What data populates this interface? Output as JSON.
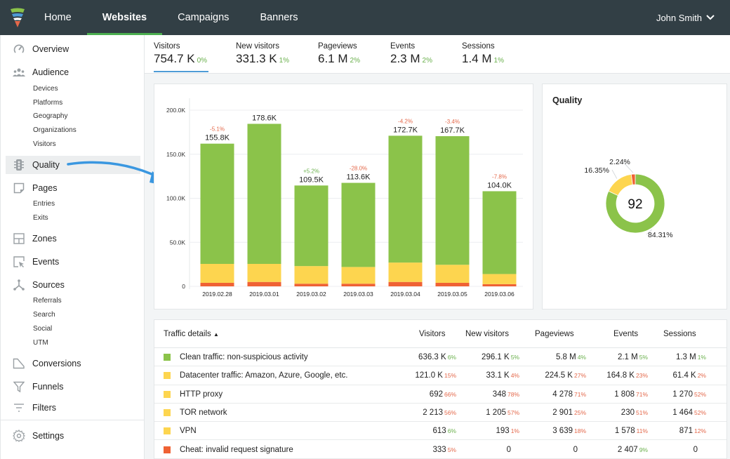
{
  "topbar": {
    "logo": "funnel-logo",
    "nav": [
      {
        "label": "Home",
        "active": false
      },
      {
        "label": "Websites",
        "active": true
      },
      {
        "label": "Campaigns",
        "active": false
      },
      {
        "label": "Banners",
        "active": false
      }
    ],
    "user": "John Smith"
  },
  "sidebar": {
    "items": [
      {
        "label": "Overview",
        "icon": "gauge-icon"
      },
      {
        "label": "Audience",
        "icon": "people-icon",
        "sub": [
          "Devices",
          "Platforms",
          "Geography",
          "Organizations",
          "Visitors"
        ]
      },
      {
        "label": "Quality",
        "icon": "traffic-light-icon",
        "active": true
      },
      {
        "label": "Pages",
        "icon": "page-icon",
        "sub": [
          "Entries",
          "Exits"
        ]
      },
      {
        "label": "Zones",
        "icon": "layout-icon"
      },
      {
        "label": "Events",
        "icon": "cursor-icon"
      },
      {
        "label": "Sources",
        "icon": "sources-icon",
        "sub": [
          "Referrals",
          "Search",
          "Social",
          "UTM"
        ]
      },
      {
        "label": "Conversions",
        "icon": "conversion-icon"
      },
      {
        "label": "Funnels",
        "icon": "funnel-icon"
      },
      {
        "label": "Filters",
        "icon": "filter-icon"
      },
      {
        "label": "Settings",
        "icon": "gear-icon"
      }
    ]
  },
  "metrics": [
    {
      "label": "Visitors",
      "value": "754.7 K",
      "change": "0%",
      "active": true
    },
    {
      "label": "New visitors",
      "value": "331.3 K",
      "change": "1%"
    },
    {
      "label": "Pageviews",
      "value": "6.1 M",
      "change": "2%"
    },
    {
      "label": "Events",
      "value": "2.3 M",
      "change": "2%"
    },
    {
      "label": "Sessions",
      "value": "1.4 M",
      "change": "1%"
    }
  ],
  "colors": {
    "clean": "#8bc34a",
    "suspicious": "#fdd54f",
    "cheat": "#ef6234",
    "up": "#6ab04c",
    "down": "#e4684a",
    "accent": "#4e9bd6",
    "topbar": "#323f45"
  },
  "chart_data": [
    {
      "type": "bar",
      "stacked": true,
      "title": "",
      "xlabel": "",
      "ylabel": "",
      "ylim": [
        0,
        200000
      ],
      "yticks": [
        "0",
        "50.0K",
        "100.0K",
        "150.0K",
        "200.0K"
      ],
      "categories": [
        "2019.02.28",
        "2019.03.01",
        "2019.03.02",
        "2019.03.03",
        "2019.03.04",
        "2019.03.05",
        "2019.03.06"
      ],
      "totals_labels": [
        "155.8K",
        "178.6K",
        "109.5K",
        "113.6K",
        "172.7K",
        "167.7K",
        "104.0K"
      ],
      "change_labels": [
        "-5.1%",
        "",
        "+5.2%",
        "-28.0%",
        "-4.2%",
        "-3.4%",
        "-7.8%"
      ],
      "series": [
        {
          "name": "Cheat",
          "color": "#ef6234",
          "values": [
            4000,
            5000,
            3000,
            3000,
            5000,
            4000,
            2500
          ]
        },
        {
          "name": "Suspicious",
          "color": "#fdd54f",
          "values": [
            21500,
            20500,
            20000,
            19000,
            22000,
            20500,
            11500
          ]
        },
        {
          "name": "Clean",
          "color": "#8bc34a",
          "values": [
            136500,
            159000,
            91500,
            95500,
            144000,
            146000,
            94000
          ]
        }
      ],
      "grid": true,
      "legend": "none"
    },
    {
      "type": "pie",
      "donut": true,
      "title": "Quality",
      "center_label": "92",
      "slices": [
        {
          "label": "84.31%",
          "value": 84.31,
          "color": "#8bc34a"
        },
        {
          "label": "16.35%",
          "value": 16.35,
          "color": "#fdd54f"
        },
        {
          "label": "2.24%",
          "value": 2.24,
          "color": "#ef6234"
        }
      ]
    }
  ],
  "table": {
    "headers": [
      "Traffic details",
      "Visitors",
      "New visitors",
      "Pageviews",
      "Events",
      "Sessions"
    ],
    "sort_indicator": "▲",
    "rows": [
      {
        "name": "Clean traffic: non-suspicious activity",
        "color": "#8bc34a",
        "cells": [
          [
            "636.3 K",
            "6%",
            "g"
          ],
          [
            "296.1 K",
            "5%",
            "g"
          ],
          [
            "5.8 M",
            "4%",
            "g"
          ],
          [
            "2.1 M",
            "5%",
            "g"
          ],
          [
            "1.3 M",
            "1%",
            "g"
          ]
        ]
      },
      {
        "name": "Datacenter traffic: Amazon, Azure, Google, etc.",
        "color": "#fdd54f",
        "cells": [
          [
            "121.0 K",
            "15%",
            "r"
          ],
          [
            "33.1 K",
            "4%",
            "r"
          ],
          [
            "224.5 K",
            "27%",
            "r"
          ],
          [
            "164.8 K",
            "23%",
            "r"
          ],
          [
            "61.4 K",
            "2%",
            "r"
          ]
        ]
      },
      {
        "name": "HTTP proxy",
        "color": "#fdd54f",
        "cells": [
          [
            "692",
            "66%",
            "r"
          ],
          [
            "348",
            "78%",
            "r"
          ],
          [
            "4 278",
            "71%",
            "r"
          ],
          [
            "1 808",
            "71%",
            "r"
          ],
          [
            "1 270",
            "52%",
            "r"
          ]
        ]
      },
      {
        "name": "TOR network",
        "color": "#fdd54f",
        "cells": [
          [
            "2 213",
            "56%",
            "r"
          ],
          [
            "1 205",
            "57%",
            "r"
          ],
          [
            "2 901",
            "25%",
            "r"
          ],
          [
            "230",
            "51%",
            "r"
          ],
          [
            "1 464",
            "52%",
            "r"
          ]
        ]
      },
      {
        "name": "VPN",
        "color": "#fdd54f",
        "cells": [
          [
            "613",
            "6%",
            "g"
          ],
          [
            "193",
            "1%",
            "r"
          ],
          [
            "3 639",
            "18%",
            "r"
          ],
          [
            "1 578",
            "11%",
            "r"
          ],
          [
            "871",
            "12%",
            "r"
          ]
        ]
      },
      {
        "name": "Cheat: invalid request signature",
        "color": "#ef6234",
        "cells": [
          [
            "333",
            "5%",
            "r"
          ],
          [
            "0",
            "",
            ""
          ],
          [
            "0",
            "",
            ""
          ],
          [
            "2 407",
            "9%",
            "g"
          ],
          [
            "0",
            "",
            ""
          ]
        ]
      }
    ]
  }
}
